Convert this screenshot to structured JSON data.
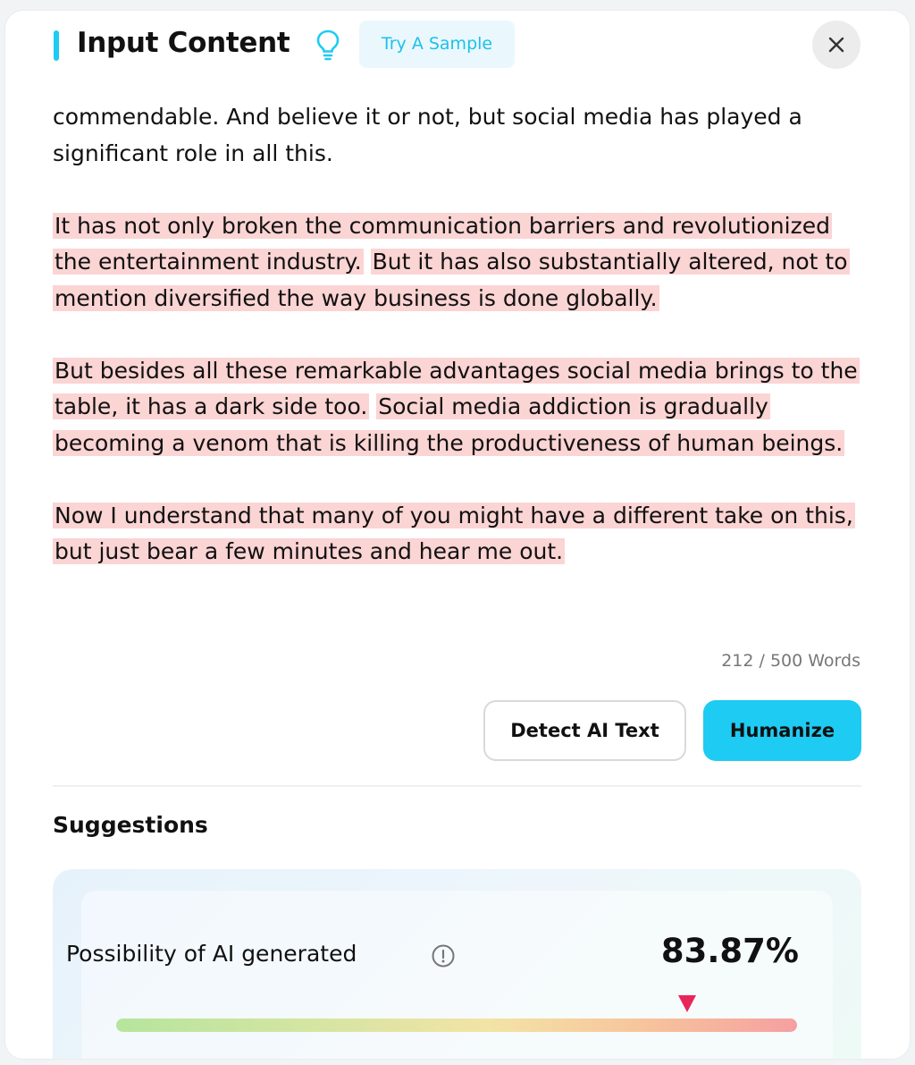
{
  "header": {
    "title": "Input Content",
    "sample_label": "Try A Sample",
    "accent_color": "#1ecbf2",
    "icons": [
      "lightbulb-icon",
      "close-icon"
    ]
  },
  "content": {
    "paragraphs": [
      {
        "segments": [
          {
            "text": "commendable. And believe it or not, but social media has played a significant role in all this.",
            "highlighted": false
          }
        ]
      },
      {
        "segments": [
          {
            "text": "It has not only broken the communication barriers and revolutionized the entertainment industry.",
            "highlighted": true
          },
          {
            "text": " ",
            "highlighted": false
          },
          {
            "text": "But it has also substantially altered, not to mention diversified the way business is done globally.",
            "highlighted": true
          }
        ]
      },
      {
        "segments": [
          {
            "text": "But besides all these remarkable advantages social media brings to the table, it has a dark side too.",
            "highlighted": true
          },
          {
            "text": " ",
            "highlighted": false
          },
          {
            "text": "Social media addiction is gradually becoming a venom that is killing the productiveness of human beings.",
            "highlighted": true
          }
        ]
      },
      {
        "segments": [
          {
            "text": "Now I understand that many of you might have a different take on this, but just bear a few minutes and hear me out.",
            "highlighted": true
          }
        ]
      }
    ],
    "highlight_color": "#fbd4d4"
  },
  "word_count": "212 / 500 Words",
  "actions": {
    "detect_label": "Detect AI Text",
    "humanize_label": "Humanize",
    "humanize_color": "#1ecbf2"
  },
  "suggestions": {
    "title": "Suggestions",
    "possibility_label": "Possibility of AI generated",
    "percent_text": "83.87%",
    "percent_value": 83.87,
    "marker_color": "#e8265a"
  }
}
